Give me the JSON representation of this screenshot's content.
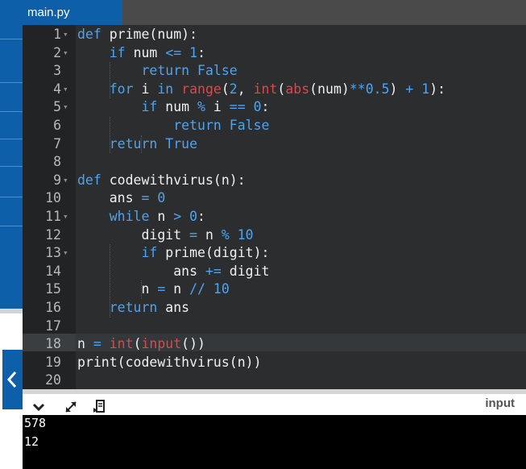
{
  "tab": {
    "title": "main.py"
  },
  "editor": {
    "lines": [
      {
        "n": "1",
        "fold": true
      },
      {
        "n": "2",
        "fold": true
      },
      {
        "n": "3",
        "fold": false
      },
      {
        "n": "4",
        "fold": true
      },
      {
        "n": "5",
        "fold": true
      },
      {
        "n": "6",
        "fold": false
      },
      {
        "n": "7",
        "fold": false
      },
      {
        "n": "8",
        "fold": false
      },
      {
        "n": "9",
        "fold": true
      },
      {
        "n": "10",
        "fold": false
      },
      {
        "n": "11",
        "fold": true
      },
      {
        "n": "12",
        "fold": false
      },
      {
        "n": "13",
        "fold": true
      },
      {
        "n": "14",
        "fold": false
      },
      {
        "n": "15",
        "fold": false
      },
      {
        "n": "16",
        "fold": false
      },
      {
        "n": "17",
        "fold": false
      },
      {
        "n": "18",
        "fold": false
      },
      {
        "n": "19",
        "fold": false
      },
      {
        "n": "20",
        "fold": false
      }
    ],
    "code": [
      "def prime(num):",
      "    if num <= 1:",
      "        return False",
      "    for i in range(2, int(abs(num)**0.5) + 1):",
      "        if num % i == 0:",
      "            return False",
      "    return True",
      "",
      "def codewithvirus(n):",
      "    ans = 0",
      "    while n > 0:",
      "        digit = n % 10",
      "        if prime(digit):",
      "            ans += digit",
      "        n = n // 10",
      "    return ans",
      "",
      "n = int(input())",
      "print(codewithvirus(n))",
      ""
    ],
    "active_line": "18"
  },
  "console": {
    "input_label": "input",
    "output": [
      "578",
      "12"
    ]
  },
  "icons": {
    "collapse": "chevron-down-icon",
    "expand": "expand-arrows-icon",
    "clear": "clear-console-icon",
    "back": "chevron-left-icon"
  },
  "colors": {
    "accent": "#0c5fa8",
    "editor_bg": "#2b2d2f",
    "keyword": "#4fa3f0",
    "builtin": "#d94a4a"
  }
}
